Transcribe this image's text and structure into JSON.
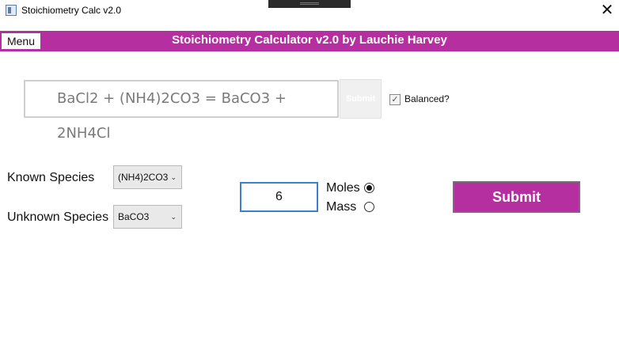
{
  "window": {
    "title": "Stoichiometry Calc v2.0",
    "close_glyph": "✕"
  },
  "header": {
    "menu_label": "Menu",
    "app_title": "Stoichiometry Calculator v2.0 by Lauchie Harvey",
    "accent_color": "#b52fa0"
  },
  "equation": {
    "value": "BaCl2 + (NH4)2CO3 = BaCO3 + 2NH4Cl",
    "submit_label": "Submit",
    "balanced_label": "Balanced?",
    "balanced_checked": true,
    "check_glyph": "✓"
  },
  "species": {
    "known_label": "Known Species",
    "known_value": "(NH4)2CO3",
    "unknown_label": "Unknown Species",
    "unknown_value": "BaCO3",
    "chevron_glyph": "⌄"
  },
  "quantity": {
    "value": "6"
  },
  "units": {
    "moles_label": "Moles",
    "mass_label": "Mass",
    "selected": "Moles"
  },
  "submit": {
    "label": "Submit"
  }
}
